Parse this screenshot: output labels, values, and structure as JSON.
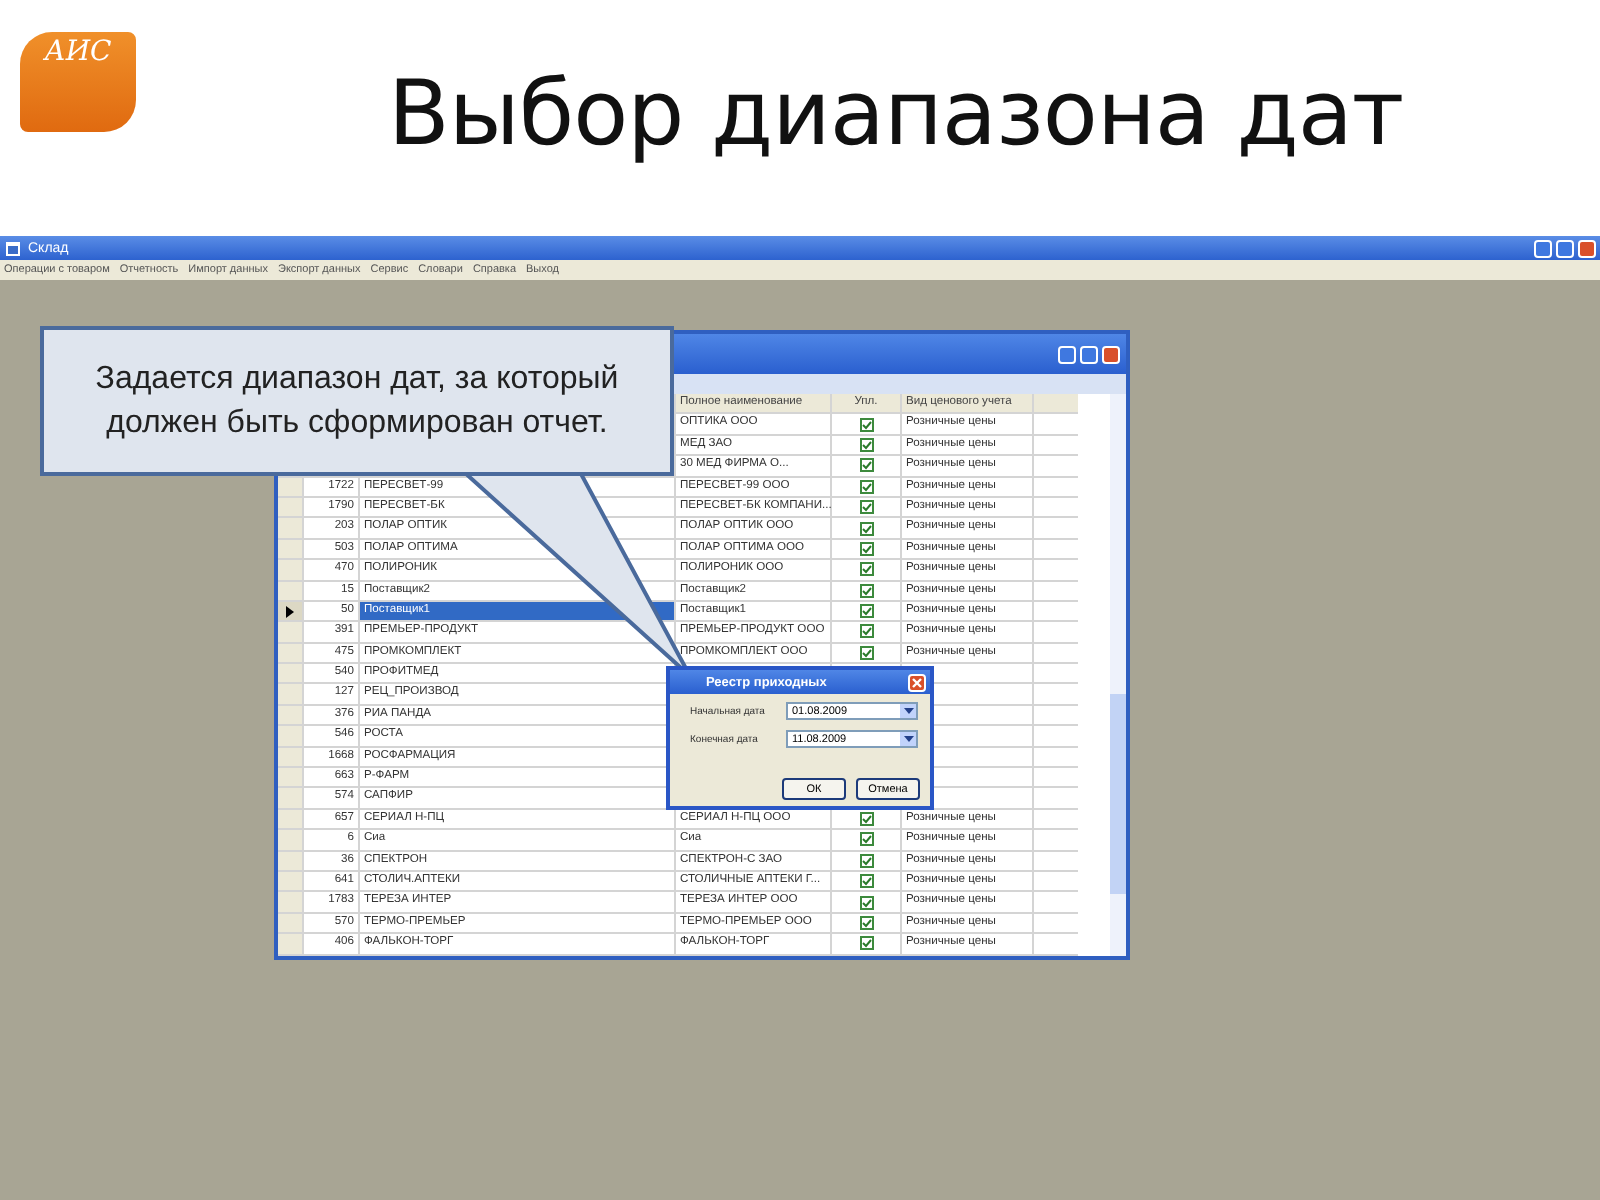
{
  "slide": {
    "title": "Выбор диапазона дат",
    "logo": {
      "text": "АИС"
    }
  },
  "app_window": {
    "title": "Склад",
    "menu": [
      "Операции с товаром",
      "Отчетность",
      "Импорт данных",
      "Экспорт данных",
      "Сервис",
      "Словари",
      "Справка",
      "Выход"
    ]
  },
  "grid": {
    "columns": [
      "Полное наименование",
      "Упл.",
      "Вид ценового учета"
    ],
    "rows": [
      {
        "full_name": "ОПТИКА ООО",
        "checked": true,
        "price_type": "Розничные цены"
      },
      {
        "full_name": "МЕД ЗАО",
        "checked": true,
        "price_type": "Розничные цены"
      },
      {
        "full_name": "30 МЕД ФИРМА О...",
        "checked": true,
        "price_type": "Розничные цены"
      },
      {
        "code": "1722",
        "name": "ПЕРЕСВЕТ-99",
        "full_name": "ПЕРЕСВЕТ-99 ООО",
        "checked": true,
        "price_type": "Розничные цены",
        "selected": false
      },
      {
        "code": "1790",
        "name": "ПЕРЕСВЕТ-БК",
        "full_name": "ПЕРЕСВЕТ-БК КОМПАНИ...",
        "checked": true,
        "price_type": "Розничные цены",
        "selected": false
      },
      {
        "code": "203",
        "name": "ПОЛАР ОПТИК",
        "full_name": "ПОЛАР ОПТИК ООО",
        "checked": true,
        "price_type": "Розничные цены",
        "selected": false
      },
      {
        "code": "503",
        "name": "ПОЛАР ОПТИМА",
        "full_name": "ПОЛАР ОПТИМА ООО",
        "checked": true,
        "price_type": "Розничные цены",
        "selected": false
      },
      {
        "code": "470",
        "name": "ПОЛИРОНИК",
        "full_name": "ПОЛИРОНИК ООО",
        "checked": true,
        "price_type": "Розничные цены",
        "selected": false
      },
      {
        "code": "15",
        "name": "Поставщик2",
        "full_name": "Поставщик2",
        "checked": true,
        "price_type": "Розничные цены",
        "selected": false
      },
      {
        "code": "50",
        "name": "Поставщик1",
        "full_name": "Поставщик1",
        "checked": true,
        "price_type": "Розничные цены",
        "selected": true
      },
      {
        "code": "391",
        "name": "ПРЕМЬЕР-ПРОДУКТ",
        "full_name": "ПРЕМЬЕР-ПРОДУКТ ООО",
        "checked": true,
        "price_type": "Розничные цены",
        "selected": false
      },
      {
        "code": "475",
        "name": "ПРОМКОМПЛЕКТ",
        "full_name": "ПРОМКОМПЛЕКТ ООО",
        "checked": true,
        "price_type": "Розничные цены",
        "selected": false
      },
      {
        "code": "540",
        "name": "ПРОФИТМЕД",
        "selected": false
      },
      {
        "code": "127",
        "name": "РЕЦ_ПРОИЗВОД",
        "selected": false
      },
      {
        "code": "376",
        "name": "РИА ПАНДА",
        "selected": false
      },
      {
        "code": "546",
        "name": "РОСТА",
        "selected": false
      },
      {
        "code": "1668",
        "name": "РОСФАРМАЦИЯ",
        "selected": false
      },
      {
        "code": "663",
        "name": "Р-ФАРМ",
        "selected": false
      },
      {
        "code": "574",
        "name": "САПФИР",
        "selected": false
      },
      {
        "code": "657",
        "name": "СЕРИАЛ Н-ПЦ",
        "full_name": "СЕРИАЛ Н-ПЦ ООО",
        "checked": true,
        "price_type": "Розничные цены",
        "selected": false
      },
      {
        "code": "6",
        "name": "Сиа",
        "full_name": "Сиа",
        "checked": true,
        "price_type": "Розничные цены",
        "selected": false
      },
      {
        "code": "36",
        "name": "СПЕКТРОН",
        "full_name": "СПЕКТРОН-С ЗАО",
        "checked": true,
        "price_type": "Розничные цены",
        "selected": false
      },
      {
        "code": "641",
        "name": "СТОЛИЧ.АПТЕКИ",
        "full_name": "СТОЛИЧНЫЕ АПТЕКИ Г...",
        "checked": true,
        "price_type": "Розничные цены",
        "selected": false
      },
      {
        "code": "1783",
        "name": "ТЕРЕЗА ИНТЕР",
        "full_name": "ТЕРЕЗА ИНТЕР ООО",
        "checked": true,
        "price_type": "Розничные цены",
        "selected": false
      },
      {
        "code": "570",
        "name": "ТЕРМО-ПРЕМЬЕР",
        "full_name": "ТЕРМО-ПРЕМЬЕР ООО",
        "checked": true,
        "price_type": "Розничные цены",
        "selected": false
      },
      {
        "code": "406",
        "name": "ФАЛЬКОН-ТОРГ",
        "full_name": "ФАЛЬКОН-ТОРГ",
        "checked": true,
        "price_type": "Розничные цены",
        "selected": false
      }
    ]
  },
  "callout": {
    "text": "Задается диапазон дат, за который должен быть сформирован отчет."
  },
  "dialog": {
    "title": "Реестр приходных",
    "fields": [
      {
        "label": "Начальная дата",
        "value": "01.08.2009"
      },
      {
        "label": "Конечная дата",
        "value": "11.08.2009"
      }
    ],
    "buttons": [
      "ОК",
      "Отмена"
    ]
  }
}
